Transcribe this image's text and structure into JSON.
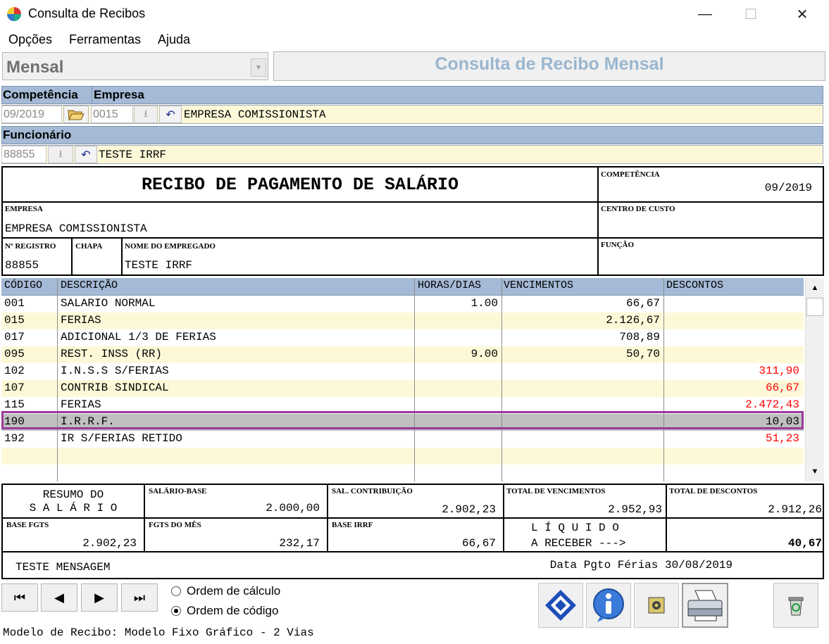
{
  "window": {
    "title": "Consulta de Recibos",
    "minimize": "—",
    "maximize": "☐",
    "close": "✕"
  },
  "menu": [
    "Opções",
    "Ferramentas",
    "Ajuda"
  ],
  "mode": {
    "value": "Mensal"
  },
  "header_title": "Consulta de Recibo Mensal",
  "filters": {
    "competencia_label": "Competência",
    "empresa_label": "Empresa",
    "competencia": "09/2019",
    "empresa_code": "0015",
    "empresa_name": "EMPRESA COMISSIONISTA",
    "funcionario_label": "Funcionário",
    "funcionario_code": "88855",
    "funcionario_name": "TESTE IRRF"
  },
  "receipt": {
    "title": "RECIBO DE PAGAMENTO DE SALÁRIO",
    "competencia_label": "COMPETÊNCIA",
    "competencia": "09/2019",
    "empresa_label": "EMPRESA",
    "empresa": "EMPRESA COMISSIONISTA",
    "centro_custo_label": "CENTRO DE CUSTO",
    "registro_label": "Nº REGISTRO",
    "registro": "88855",
    "chapa_label": "CHAPA",
    "nome_label": "NOME DO EMPREGADO",
    "nome": "TESTE IRRF",
    "funcao_label": "FUNÇÃO"
  },
  "table": {
    "headers": [
      "CÓDIGO",
      "DESCRIÇÃO",
      "HORAS/DIAS",
      "VENCIMENTOS",
      "DESCONTOS"
    ],
    "rows": [
      [
        "001",
        "SALARIO NORMAL",
        "1.00",
        "66,67",
        ""
      ],
      [
        "015",
        "FERIAS",
        "",
        "2.126,67",
        ""
      ],
      [
        "017",
        "ADICIONAL 1/3 DE FERIAS",
        "",
        "708,89",
        ""
      ],
      [
        "095",
        "REST. INSS (RR)",
        "9.00",
        "50,70",
        ""
      ],
      [
        "102",
        "I.N.S.S S/FERIAS",
        "",
        "",
        "311,90"
      ],
      [
        "107",
        "CONTRIB SINDICAL",
        "",
        "",
        "66,67"
      ],
      [
        "115",
        "FERIAS",
        "",
        "",
        "2.472,43"
      ],
      [
        "190",
        "I.R.R.F.",
        "",
        "",
        "10,03"
      ],
      [
        "192",
        "IR S/FERIAS RETIDO",
        "",
        "",
        "51,23"
      ]
    ],
    "discount_color": "#ff0000",
    "selected_row": 7
  },
  "summary": {
    "resumo_line1": "RESUMO DO",
    "resumo_line2": "S A L Á R I O",
    "salario_base_label": "SALÁRIO-BASE",
    "salario_base": "2.000,00",
    "sal_contrib_label": "SAL. CONTRIBUIÇÃO",
    "sal_contrib": "2.902,23",
    "total_venc_label": "TOTAL DE VENCIMENTOS",
    "total_venc": "2.952,93",
    "total_desc_label": "TOTAL DE DESCONTOS",
    "total_desc": "2.912,26",
    "base_fgts_label": "BASE FGTS",
    "base_fgts": "2.902,23",
    "fgts_mes_label": "FGTS DO MÊS",
    "fgts_mes": "232,17",
    "base_irrf_label": "BASE IRRF",
    "base_irrf": "66,67",
    "liquido_line1": "L Í Q U I D O",
    "liquido_line2": "A RECEBER --->",
    "liquido": "40,67",
    "mensagem": "TESTE MENSAGEM",
    "data_pgto": "Data Pgto Férias 30/08/2019"
  },
  "order": {
    "calc": "Ordem de cálculo",
    "code": "Ordem de código",
    "selected": "code"
  },
  "status": "Modelo de Recibo: Modelo Fixo Gráfico - 2 Vias",
  "colors": {
    "accent": "#a4bad6",
    "row_alt": "#fdf9d8",
    "highlight": "#9b3a9b"
  }
}
